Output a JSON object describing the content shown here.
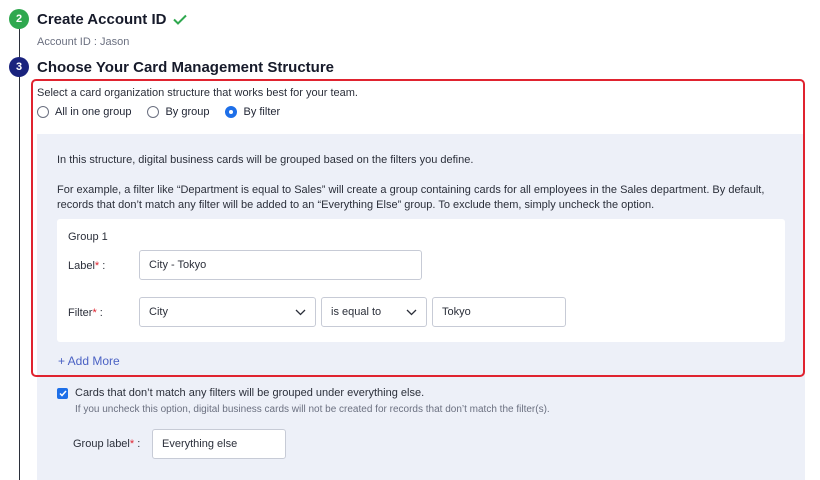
{
  "steps": [
    {
      "number": "2",
      "title": "Create Account ID",
      "subtitle": "Account ID : Jason",
      "status_icon": "check-icon",
      "color": "#2fa84f"
    },
    {
      "number": "3",
      "title": "Choose Your Card Management Structure",
      "color": "#1a237e"
    }
  ],
  "structure": {
    "intro": "Select a card organization structure that works best for your team.",
    "options": [
      {
        "label": "All in one group",
        "selected": false
      },
      {
        "label": "By group",
        "selected": false
      },
      {
        "label": "By filter",
        "selected": true
      }
    ],
    "description_1": "In this structure, digital business cards will be grouped based on the filters you define.",
    "description_2": "For example, a filter like “Department is equal to Sales” will create a group containing cards for all employees in the Sales department. By default, records that don’t match any filter will be added to an “Everything Else” group. To exclude them, simply uncheck the option."
  },
  "group": {
    "title": "Group 1",
    "label_field": {
      "label": "Label",
      "required_mark": "*",
      "colon": ":",
      "value": "City - Tokyo"
    },
    "filter_field": {
      "label": "Filter",
      "required_mark": "*",
      "colon": ":",
      "field": "City",
      "operator": "is equal to",
      "value": "Tokyo"
    }
  },
  "add_more": "+ Add More",
  "everything_else": {
    "checked": true,
    "label": "Cards that don’t match any filters will be grouped under everything else.",
    "help": "If you uncheck this option, digital business cards will not be created for records that don’t match the filter(s).",
    "group_label": {
      "label": "Group label",
      "required_mark": "*",
      "colon": ":",
      "value": "Everything else"
    }
  },
  "colors": {
    "accent": "#1e6fe8",
    "highlight": "#e0232f",
    "panel": "#edf0f8",
    "link": "#4b62c4"
  }
}
